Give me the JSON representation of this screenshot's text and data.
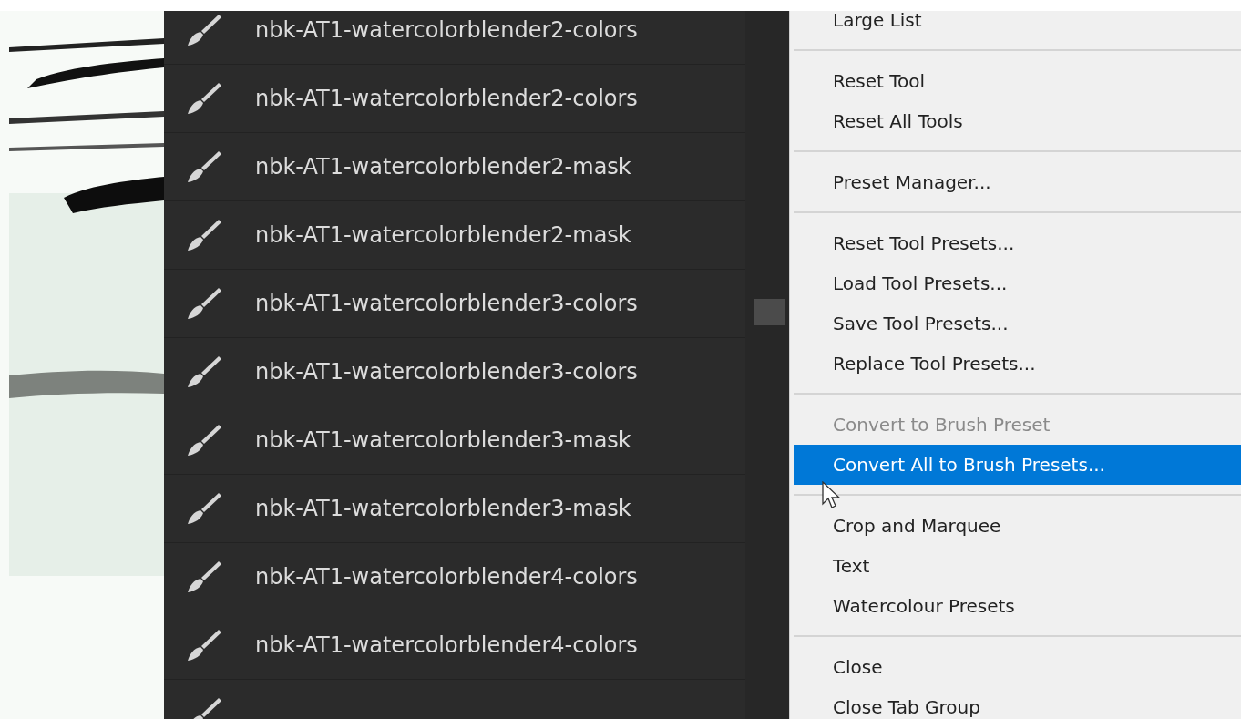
{
  "preset_list": {
    "rows": [
      {
        "name": "nbk-AT1-watercolorblender2-colors"
      },
      {
        "name": "nbk-AT1-watercolorblender2-colors"
      },
      {
        "name": "nbk-AT1-watercolorblender2-mask"
      },
      {
        "name": "nbk-AT1-watercolorblender2-mask"
      },
      {
        "name": "nbk-AT1-watercolorblender3-colors"
      },
      {
        "name": "nbk-AT1-watercolorblender3-colors"
      },
      {
        "name": "nbk-AT1-watercolorblender3-mask"
      },
      {
        "name": "nbk-AT1-watercolorblender3-mask"
      },
      {
        "name": "nbk-AT1-watercolorblender4-colors"
      },
      {
        "name": "nbk-AT1-watercolorblender4-colors"
      }
    ]
  },
  "context_menu": {
    "items": [
      {
        "kind": "item",
        "label": "Large List",
        "disabled": false,
        "selected": false
      },
      {
        "kind": "separator"
      },
      {
        "kind": "item",
        "label": "Reset Tool",
        "disabled": false,
        "selected": false
      },
      {
        "kind": "item",
        "label": "Reset All Tools",
        "disabled": false,
        "selected": false
      },
      {
        "kind": "separator"
      },
      {
        "kind": "item",
        "label": "Preset Manager...",
        "disabled": false,
        "selected": false
      },
      {
        "kind": "separator"
      },
      {
        "kind": "item",
        "label": "Reset Tool Presets...",
        "disabled": false,
        "selected": false
      },
      {
        "kind": "item",
        "label": "Load Tool Presets...",
        "disabled": false,
        "selected": false
      },
      {
        "kind": "item",
        "label": "Save Tool Presets...",
        "disabled": false,
        "selected": false
      },
      {
        "kind": "item",
        "label": "Replace Tool Presets...",
        "disabled": false,
        "selected": false
      },
      {
        "kind": "separator"
      },
      {
        "kind": "item",
        "label": "Convert to Brush Preset",
        "disabled": true,
        "selected": false
      },
      {
        "kind": "item",
        "label": "Convert All to Brush Presets...",
        "disabled": false,
        "selected": true
      },
      {
        "kind": "separator"
      },
      {
        "kind": "item",
        "label": "Crop and Marquee",
        "disabled": false,
        "selected": false
      },
      {
        "kind": "item",
        "label": "Text",
        "disabled": false,
        "selected": false
      },
      {
        "kind": "item",
        "label": "Watercolour Presets",
        "disabled": false,
        "selected": false
      },
      {
        "kind": "separator"
      },
      {
        "kind": "item",
        "label": "Close",
        "disabled": false,
        "selected": false
      },
      {
        "kind": "item",
        "label": "Close Tab Group",
        "disabled": false,
        "selected": false
      }
    ]
  }
}
